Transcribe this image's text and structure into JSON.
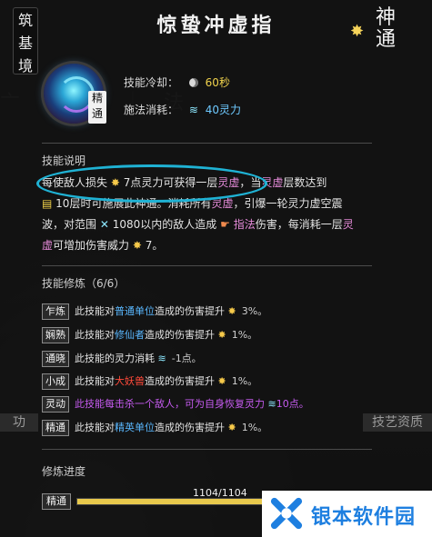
{
  "header": {
    "title": "惊蛰冲虚指",
    "realm_tag": [
      "筑",
      "基",
      "境"
    ],
    "grade_badge": [
      "神",
      "通"
    ]
  },
  "skill": {
    "mastery_tag": [
      "精",
      "通"
    ],
    "cooldown_label": "技能冷却：",
    "cooldown_value": "60秒",
    "cost_label": "施法消耗：",
    "cost_value": "40灵力"
  },
  "description": {
    "heading": "技能说明",
    "l1_a": "每使敌人损失",
    "l1_b": "7点灵力可获得一层",
    "l1_c": "灵虚",
    "l1_d": "，当",
    "l1_e": "灵虚",
    "l1_f": "层数达到",
    "l2_a": "10层时可施展此神通。消耗所有",
    "l2_b": "灵虚",
    "l2_c": "，引爆一轮灵力虚空震",
    "l3_a": "波，对范围",
    "l3_b": "1080",
    "l3_c": "以内的敌人造成",
    "l3_d": "指法",
    "l3_e": "伤害，每消耗一层",
    "l3_f": "灵",
    "l4_a": "虚",
    "l4_b": "可增加伤害威力",
    "l4_c": "7。"
  },
  "training": {
    "heading": "技能修炼（6/6）",
    "rows": [
      {
        "tag": "乍炼",
        "a": "此技能对",
        "hl": "普通单位",
        "b": "造成的伤害提升",
        "pct": "3%。"
      },
      {
        "tag": "娴熟",
        "a": "此技能对",
        "hl": "修仙者",
        "b": "造成的伤害提升",
        "pct": "1%。"
      },
      {
        "tag": "通晓",
        "a": "此技能的灵力消耗",
        "hl": "",
        "b": "",
        "pct": "-1点。"
      },
      {
        "tag": "小成",
        "a": "此技能对",
        "hl": "大妖兽",
        "b": "造成的伤害提升",
        "pct": "1%。"
      },
      {
        "tag": "灵动",
        "a": "此技能每击杀一个敌人，可为自身恢复灵力",
        "hl": "",
        "b": "",
        "pct": "10点。"
      },
      {
        "tag": "精通",
        "a": "此技能对",
        "hl": "精英单位",
        "b": "造成的伤害提升",
        "pct": "1%。"
      }
    ]
  },
  "progress": {
    "heading": "修炼进度",
    "tag": "精通",
    "text": "1104/1104",
    "fraction": 1.0
  },
  "side": {
    "left_tab": "功",
    "right_tab": "技艺资质"
  },
  "watermark": {
    "text": "银本软件园"
  },
  "colors": {
    "highlight_blue": "#5ab8ff",
    "highlight_pink": "#e58bd9",
    "highlight_red": "#ff4a3a",
    "highlight_purple": "#c65bf0",
    "accent_gold": "#f2d24a",
    "annotation_oval": "#1fb2d4"
  }
}
